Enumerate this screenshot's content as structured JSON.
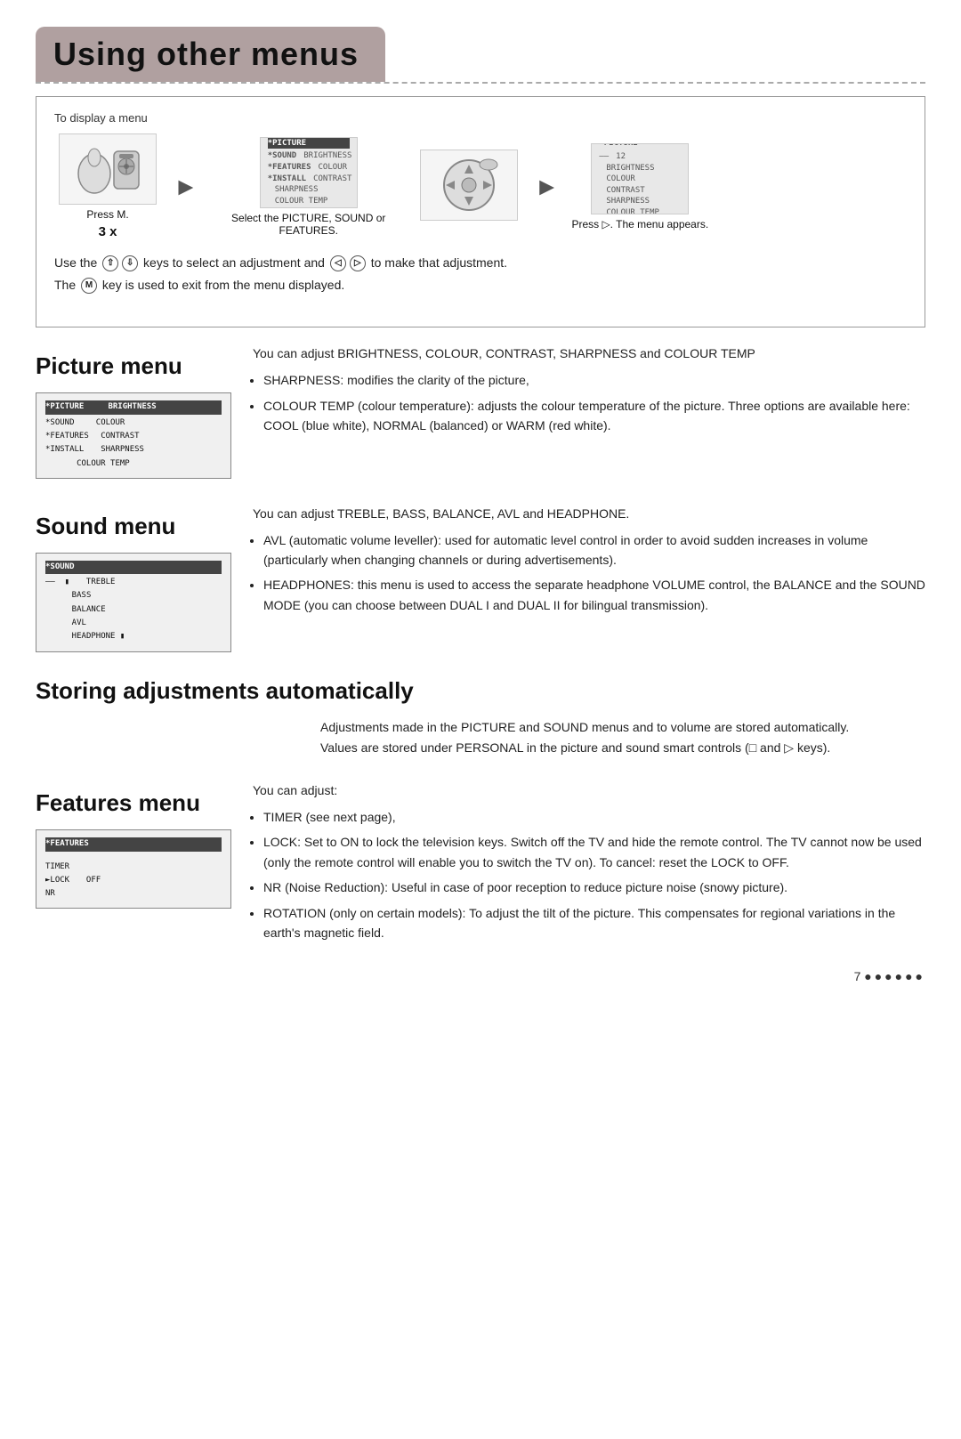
{
  "page": {
    "title": "Using other menus",
    "page_number": "7"
  },
  "top_section": {
    "label": "To display a menu",
    "step1_label": "Press",
    "step1_key": "MENU",
    "step1_times": "3 x",
    "step2_label": "Select the PICTURE, SOUND or FEATURES.",
    "step3_label": "Press ▷. The menu appears.",
    "keys_line1": "Use the ↑ ↓ keys to select an adjustment and ◁ ▷ to make that adjustment.",
    "keys_line2": "The MENU key is used to exit from the menu displayed."
  },
  "picture_menu": {
    "title": "Picture menu",
    "menu_title": "*PICTURE",
    "menu_items": [
      {
        "left": "*SOUND",
        "right": "BRIGHTNESS"
      },
      {
        "left": "*FEATURES",
        "right": "COLOUR"
      },
      {
        "left": "*INSTALL",
        "right": "CONTRAST"
      },
      {
        "left": "",
        "right": "SHARPNESS"
      },
      {
        "left": "",
        "right": "COLOUR TEMP"
      }
    ],
    "desc_intro": "You can adjust BRIGHTNESS, COLOUR, CONTRAST, SHARPNESS and COLOUR TEMP",
    "bullets": [
      "SHARPNESS: modifies the clarity of the picture,",
      "COLOUR TEMP (colour temperature): adjusts the colour temperature of the picture. Three options are available here: COOL (blue white), NORMAL (balanced) or WARM (red white)."
    ]
  },
  "sound_menu": {
    "title": "Sound menu",
    "menu_title": "*SOUND",
    "menu_items": [
      {
        "left": "——",
        "right": "TREBLE"
      },
      {
        "left": "",
        "right": "BASS"
      },
      {
        "left": "",
        "right": "BALANCE"
      },
      {
        "left": "",
        "right": "AVL"
      },
      {
        "left": "",
        "right": "HEADPHONE"
      }
    ],
    "desc_intro": "You can adjust TREBLE, BASS, BALANCE, AVL and HEADPHONE.",
    "bullets": [
      "AVL (automatic volume leveller): used for automatic level control in order to avoid sudden increases in volume (particularly when changing channels or during advertisements).",
      "HEADPHONES: this menu is used to access the separate headphone VOLUME control, the BALANCE and the SOUND MODE (you can choose between DUAL I and DUAL II for bilingual transmission)."
    ]
  },
  "storing_section": {
    "title": "Storing adjustments automatically",
    "line1": "Adjustments made in the PICTURE and SOUND menus and to volume are stored automatically.",
    "line2": "Values are stored under PERSONAL in the picture and sound smart controls (□ and ▷ keys)."
  },
  "features_menu": {
    "title": "Features menu",
    "menu_title": "*FEATURES",
    "menu_items": [
      {
        "left": "TIMER",
        "right": ""
      },
      {
        "left": "►LOCK",
        "right": "OFF"
      },
      {
        "left": "NR",
        "right": ""
      }
    ],
    "desc_intro": "You can adjust:",
    "bullets": [
      "TIMER (see next page),",
      "LOCK: Set to ON to lock the television keys. Switch off the TV and hide the remote control. The TV cannot now be used (only the remote control will enable you to switch the TV on). To cancel: reset the LOCK to OFF.",
      "NR (Noise Reduction): Useful in case of poor reception to reduce picture noise (snowy picture).",
      "ROTATION (only on certain models): To adjust the tilt of the picture. This compensates for regional variations in the earth's magnetic field."
    ]
  }
}
